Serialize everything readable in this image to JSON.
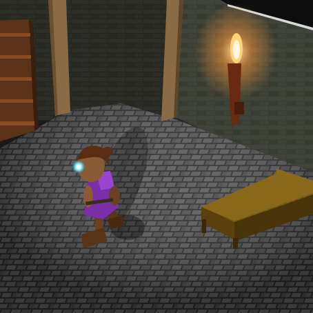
{
  "scene": {
    "colors": {
      "wall": "#3a3d31",
      "wall_mortar": "#24261f",
      "floor": "#4f4f4f",
      "floor_mortar": "#2a2a2a",
      "beam": "#8a6b45",
      "shelf": "#6a3a1e",
      "torch_flame": "#ffd37a",
      "torch_glow": "#ff9a3c",
      "character_dress": "#7a2fa8",
      "character_skin": "#8a5a34",
      "gem": "#7ee8ff",
      "bed_frame": "#7a5a22",
      "bed_sheet": "#8a6a1a"
    },
    "objects": [
      {
        "id": "bookshelf",
        "icon": "bookshelf-icon"
      },
      {
        "id": "wooden-beam-left",
        "icon": "beam-icon"
      },
      {
        "id": "wooden-beam-right",
        "icon": "beam-icon"
      },
      {
        "id": "wall-torch",
        "icon": "torch-icon"
      },
      {
        "id": "player-character",
        "icon": "character-icon"
      },
      {
        "id": "bed",
        "icon": "bed-icon"
      }
    ]
  }
}
